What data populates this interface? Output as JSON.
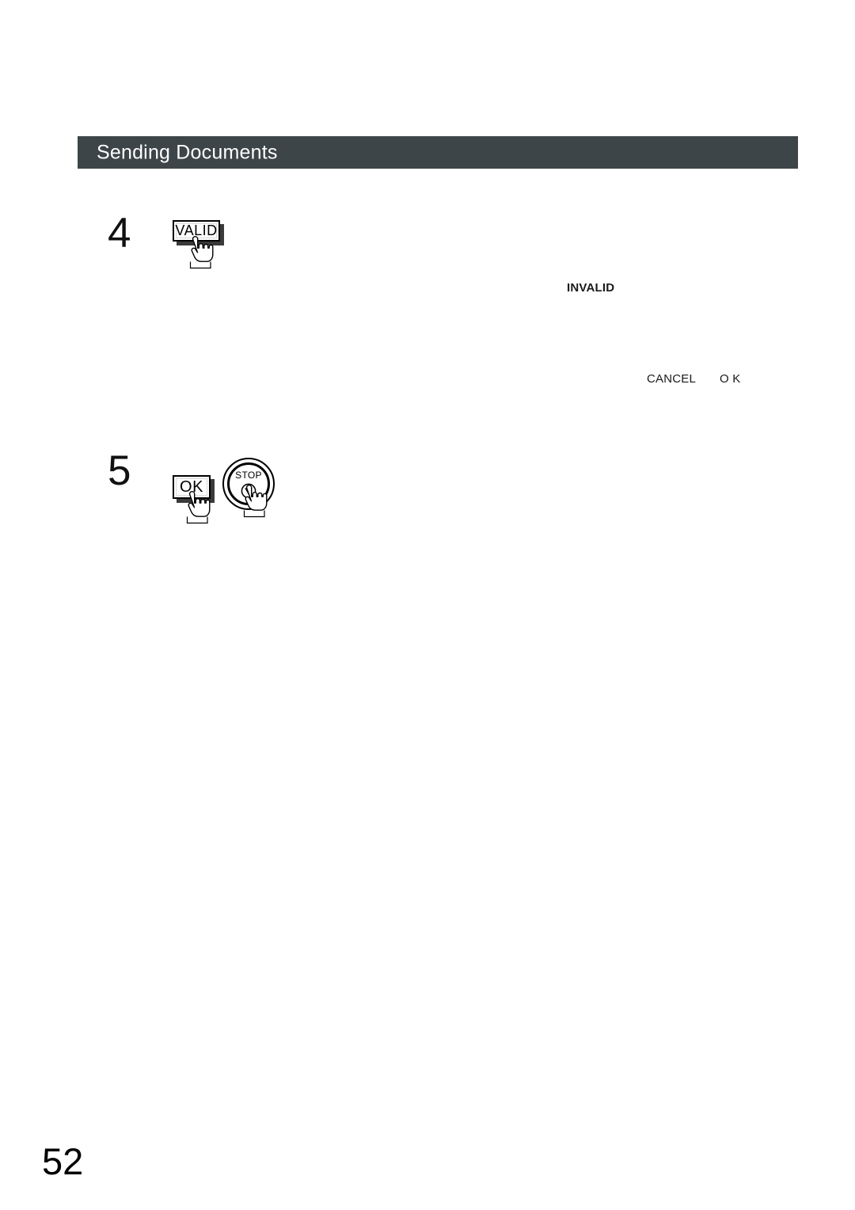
{
  "document": {
    "page_number": "52"
  },
  "header": {
    "title": "Sending Documents",
    "bar_color": "#3d4548",
    "title_color": "#ffffff"
  },
  "steps": [
    {
      "number": "4",
      "controls": [
        {
          "type": "panel-button",
          "label": "VALID",
          "icon": "pointing-hand-icon"
        }
      ]
    },
    {
      "number": "5",
      "controls": [
        {
          "type": "panel-button",
          "label": "OK",
          "icon": "pointing-hand-icon"
        },
        {
          "type": "round-button",
          "label": "STOP",
          "glyph": "stop-triangle-icon",
          "icon": "pointing-hand-icon"
        }
      ]
    }
  ],
  "display_labels": {
    "invalid": "INVALID",
    "cancel": "CANCEL",
    "ok": "O K"
  }
}
